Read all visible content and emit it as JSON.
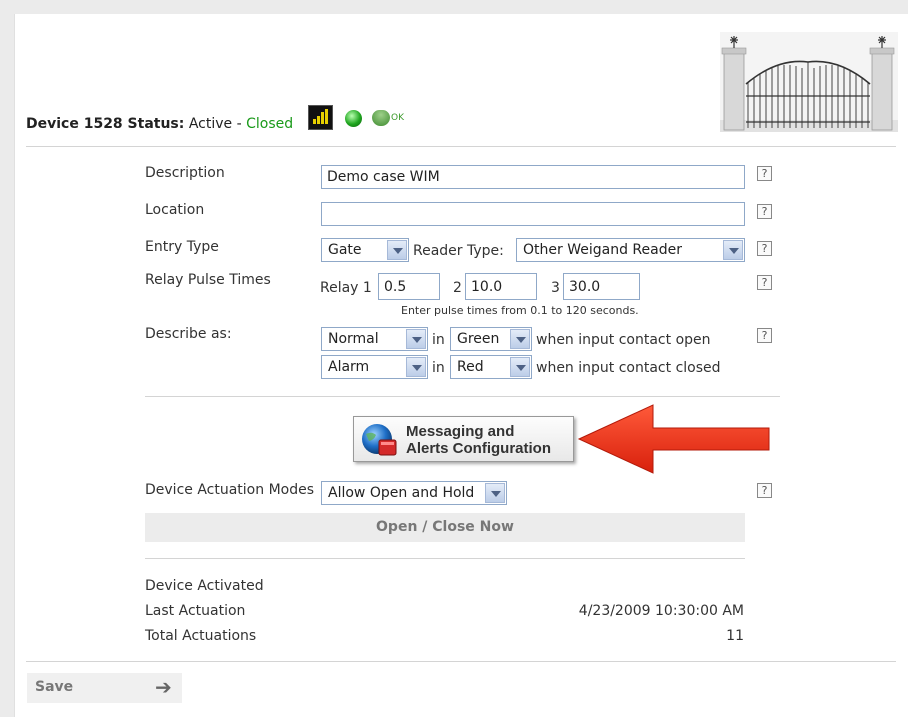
{
  "header": {
    "device_label": "Device 1528 Status:",
    "status_active": "Active",
    "status_separator": "-",
    "status_closed": "Closed",
    "ok_label": "OK"
  },
  "form": {
    "description": {
      "label": "Description",
      "value": "Demo case WIM"
    },
    "location": {
      "label": "Location",
      "value": ""
    },
    "entry_type": {
      "label": "Entry Type",
      "selected": "Gate",
      "reader_label": "Reader Type:",
      "reader_selected": "Other Weigand Reader"
    },
    "relay": {
      "label": "Relay Pulse Times",
      "relay1_label": "Relay 1",
      "relay1_value": "0.5",
      "relay2_label": "2",
      "relay2_value": "10.0",
      "relay3_label": "3",
      "relay3_value": "30.0",
      "hint": "Enter pulse times from 0.1 to 120 seconds."
    },
    "describe_as": {
      "label": "Describe as:",
      "row1": {
        "state": "Normal",
        "in": "in",
        "color": "Green",
        "text": "when input contact open"
      },
      "row2": {
        "state": "Alarm",
        "in": "in",
        "color": "Red",
        "text": "when input contact closed"
      }
    },
    "help": "?"
  },
  "messaging_button": {
    "line1": "Messaging and",
    "line2": "Alerts Configuration"
  },
  "actuation": {
    "label": "Device Actuation Modes",
    "selected": "Allow Open and Hold"
  },
  "open_close_button": "Open / Close Now",
  "stats": {
    "activated_label": "Device Activated",
    "last_label": "Last Actuation",
    "last_value": "4/23/2009 10:30:00 AM",
    "total_label": "Total Actuations",
    "total_value": "11"
  },
  "footer": {
    "save_label": "Save",
    "arrow": "➔"
  },
  "colors": {
    "status_green": "#1a9a1a",
    "arrow_red": "#e8321c"
  }
}
